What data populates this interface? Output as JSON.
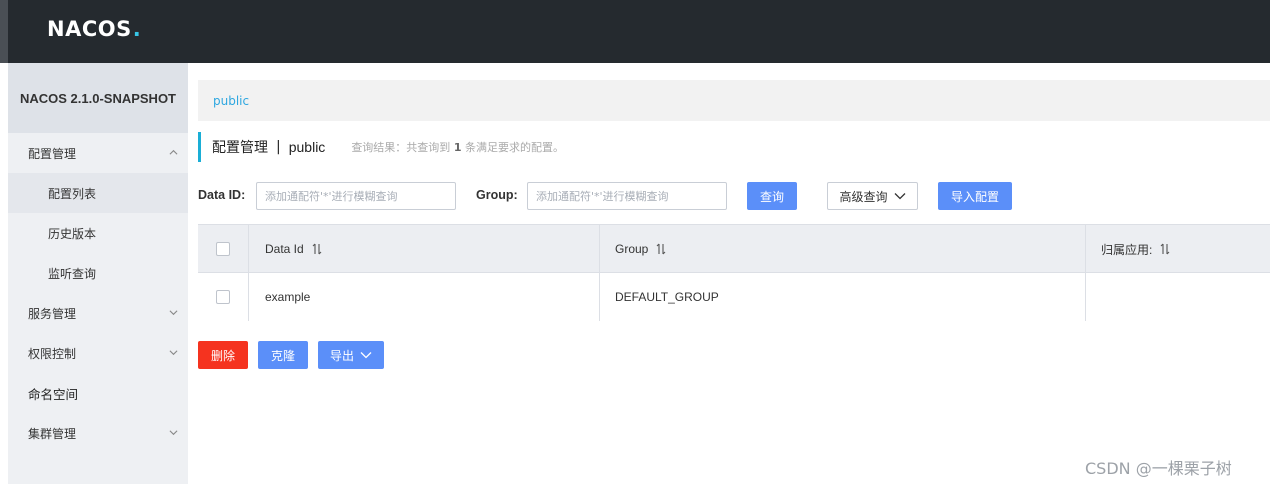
{
  "header": {
    "logo_text": "NACOS",
    "logo_dot": "."
  },
  "sidebar": {
    "version": "NACOS 2.1.0-SNAPSHOT",
    "items": [
      {
        "label": "配置管理",
        "expanded": true
      },
      {
        "label": "配置列表"
      },
      {
        "label": "历史版本"
      },
      {
        "label": "监听查询"
      },
      {
        "label": "服务管理"
      },
      {
        "label": "权限控制"
      },
      {
        "label": "命名空间"
      },
      {
        "label": "集群管理"
      }
    ]
  },
  "breadcrumb": {
    "namespace": "public"
  },
  "page": {
    "title": "配置管理",
    "separator": "|",
    "namespace": "public",
    "result_prefix": "查询结果：共查询到",
    "result_count": "1",
    "result_suffix": "条满足要求的配置。"
  },
  "search": {
    "dataid_label": "Data ID:",
    "dataid_placeholder": "添加通配符'*'进行模糊查询",
    "group_label": "Group:",
    "group_placeholder": "添加通配符'*'进行模糊查询",
    "query_button": "查询",
    "advanced_button": "高级查询",
    "import_button": "导入配置"
  },
  "table": {
    "columns": [
      "Data Id",
      "Group",
      "归属应用:"
    ],
    "rows": [
      {
        "data_id": "example",
        "group": "DEFAULT_GROUP",
        "app": ""
      }
    ]
  },
  "actions": {
    "delete": "删除",
    "clone": "克隆",
    "export": "导出"
  },
  "watermark": "CSDN @一棵栗子树",
  "colors": {
    "primary": "#5b8ff9",
    "danger": "#f5331f",
    "topbar": "#252a2f",
    "accent": "#1aaed6",
    "link": "#2ea7e0"
  }
}
